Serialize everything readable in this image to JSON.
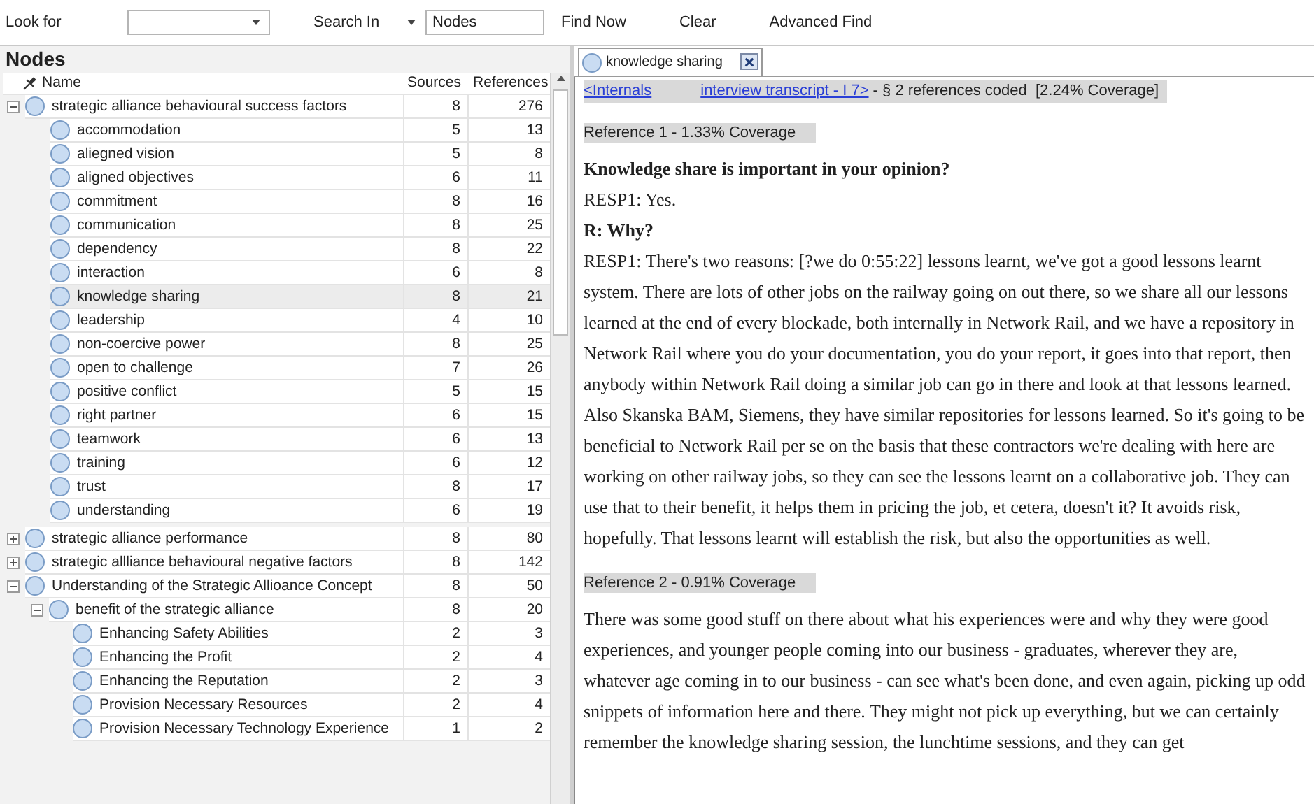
{
  "toolbar": {
    "look_for_label": "Look for",
    "search_in_label": "Search In",
    "search_in_value": "Nodes",
    "buttons": [
      "Find Now",
      "Clear",
      "Advanced Find"
    ]
  },
  "nodes_panel": {
    "title": "Nodes",
    "columns": [
      "Name",
      "Sources",
      "References"
    ],
    "nodes": [
      {
        "name": "strategic alliance behavioural success factors",
        "sources": "8",
        "references": "276",
        "expanded": true,
        "selected": false,
        "children": [
          {
            "name": "accommodation",
            "sources": "5",
            "references": "13",
            "selected": false
          },
          {
            "name": "aliegned vision",
            "sources": "5",
            "references": "8",
            "selected": false
          },
          {
            "name": "aligned objectives",
            "sources": "6",
            "references": "11",
            "selected": false
          },
          {
            "name": "commitment",
            "sources": "8",
            "references": "16",
            "selected": false
          },
          {
            "name": "communication",
            "sources": "8",
            "references": "25",
            "selected": false
          },
          {
            "name": "dependency",
            "sources": "8",
            "references": "22",
            "selected": false
          },
          {
            "name": "interaction",
            "sources": "6",
            "references": "8",
            "selected": false
          },
          {
            "name": "knowledge sharing",
            "sources": "8",
            "references": "21",
            "selected": true
          },
          {
            "name": "leadership",
            "sources": "4",
            "references": "10",
            "selected": false
          },
          {
            "name": "non-coercive power",
            "sources": "8",
            "references": "25",
            "selected": false
          },
          {
            "name": "open to challenge",
            "sources": "7",
            "references": "26",
            "selected": false
          },
          {
            "name": "positive conflict",
            "sources": "5",
            "references": "15",
            "selected": false
          },
          {
            "name": "right partner",
            "sources": "6",
            "references": "15",
            "selected": false
          },
          {
            "name": "teamwork",
            "sources": "6",
            "references": "13",
            "selected": false
          },
          {
            "name": "training",
            "sources": "6",
            "references": "12",
            "selected": false
          },
          {
            "name": "trust",
            "sources": "8",
            "references": "17",
            "selected": false
          },
          {
            "name": "understanding",
            "sources": "6",
            "references": "19",
            "selected": false
          }
        ]
      },
      {
        "name": "strategic alliance performance",
        "sources": "8",
        "references": "80",
        "expanded": false,
        "selected": false
      },
      {
        "name": "strategic allliance behavioural negative factors",
        "sources": "8",
        "references": "142",
        "expanded": false,
        "selected": false
      },
      {
        "name": "Understanding of the Strategic Allioance Concept",
        "sources": "8",
        "references": "50",
        "expanded": true,
        "selected": false,
        "children": [
          {
            "name": "benefit of the strategic alliance",
            "sources": "8",
            "references": "20",
            "expanded": true,
            "selected": false,
            "children": [
              {
                "name": "Enhancing Safety Abilities",
                "sources": "2",
                "references": "3",
                "selected": false
              },
              {
                "name": "Enhancing the Profit",
                "sources": "2",
                "references": "4",
                "selected": false
              },
              {
                "name": "Enhancing the Reputation",
                "sources": "2",
                "references": "3",
                "selected": false
              },
              {
                "name": "Provision Necessary Resources",
                "sources": "2",
                "references": "4",
                "selected": false
              },
              {
                "name": "Provision Necessary Technology Experience",
                "sources": "1",
                "references": "2",
                "selected": false
              }
            ]
          }
        ]
      }
    ]
  },
  "detail": {
    "tab": {
      "label": "knowledge sharing",
      "selected": true
    },
    "source_link": [
      "<Internals",
      "interview transcript - I 7>"
    ],
    "summary": " - § 2 references coded  [2.24% Coverage]",
    "blocks": [
      {
        "kind": "reference",
        "text": "Reference 1 - 1.33% Coverage"
      },
      {
        "kind": "question",
        "text": "Knowledge share is important in your opinion?"
      },
      {
        "kind": "text",
        "text": "RESP1: Yes."
      },
      {
        "kind": "question",
        "text": "R: Why?"
      },
      {
        "kind": "text",
        "text": "RESP1: There's two reasons: [?we do 0:55:22] lessons learnt, we've got a good lessons learnt system. There are lots of other jobs on the railway going on out there, so we share all our lessons learned at the end of every blockade, both internally in Network Rail, and we have a repository in Network Rail where you do your documentation, you do your report, it goes into that report, then anybody within Network Rail doing a similar job can go in there and look at that lessons learned. Also Skanska BAM, Siemens, they have similar repositories for lessons learned. So it's going to be beneficial to Network Rail per se on the basis that these contractors we're dealing with here are working on other railway jobs, so they can see the lessons learnt on a collaborative job. They can use that to their benefit, it helps them in pricing the job, et cetera, doesn't it? It avoids risk, hopefully. That lessons learnt will establish the risk, but also the opportunities as well."
      },
      {
        "kind": "reference",
        "text": "Reference 2 - 0.91% Coverage"
      },
      {
        "kind": "text",
        "text": "There was some good stuff on there about what his experiences were and why they were good experiences, and younger people coming into our business - graduates, wherever they are, whatever age coming in to our business - can see what's been done, and even again, picking up odd snippets of information here and there. They might not pick up everything, but we can certainly remember the knowledge sharing session, the lunchtime sessions, and they can get"
      }
    ]
  }
}
